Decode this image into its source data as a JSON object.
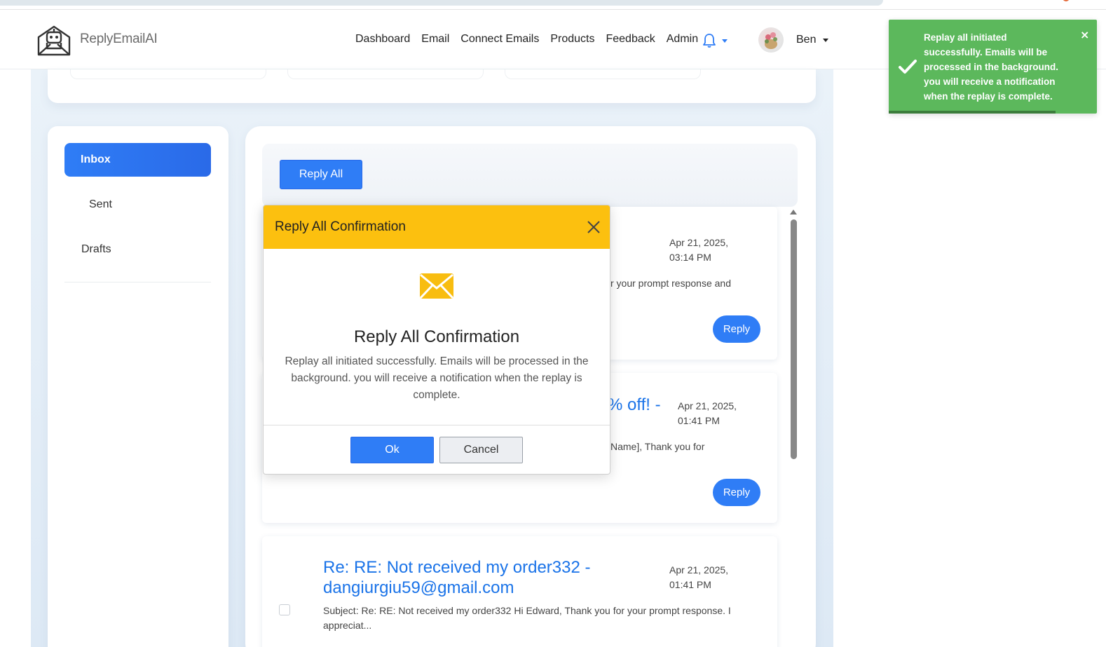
{
  "app": {
    "brand": "ReplyEmailAI"
  },
  "nav": {
    "links": [
      "Dashboard",
      "Email",
      "Connect Emails",
      "Products",
      "Feedback",
      "Admin"
    ],
    "user_name": "Ben"
  },
  "sidebar": {
    "items": [
      {
        "label": "Inbox",
        "active": true
      },
      {
        "label": "Sent"
      },
      {
        "label": "Drafts"
      }
    ]
  },
  "toolbar": {
    "reply_all_label": "Reply All"
  },
  "emails": [
    {
      "date_line1": "Apr 21, 2025,",
      "date_line2": "03:14 PM",
      "snippet_visible": "r your prompt response and",
      "reply_label": "Reply"
    },
    {
      "subject_visible": "% off! -",
      "date_line1": "Apr 21, 2025,",
      "date_line2": "01:41 PM",
      "snippet_visible": "Name], Thank you for",
      "reply_label": "Reply"
    },
    {
      "subject_line1": "Re: RE: Not received my order332 -",
      "subject_line2": "dangiurgiu59@gmail.com",
      "date_line1": "Apr 21, 2025,",
      "date_line2": "01:41 PM",
      "snippet_line1": "Subject: Re: RE: Not received my order332 Hi Edward, Thank you for your prompt response. I",
      "snippet_line2": "appreciat..."
    }
  ],
  "modal": {
    "title": "Reply All Confirmation",
    "heading": "Reply All Confirmation",
    "message": "Replay all initiated successfully. Emails will be processed in the background. you will receive a notification when the replay is complete.",
    "ok_label": "Ok",
    "cancel_label": "Cancel",
    "header_color": "#fcc00f",
    "icon": "envelope-icon"
  },
  "toast": {
    "message": "Replay all initiated successfully. Emails will be processed in the background. you will receive a notification when the replay is complete.",
    "close_label": "×",
    "progress": 0.8,
    "color": "#5cb85c"
  },
  "colors": {
    "accent": "#2f7df6",
    "link": "#1a73e8"
  }
}
